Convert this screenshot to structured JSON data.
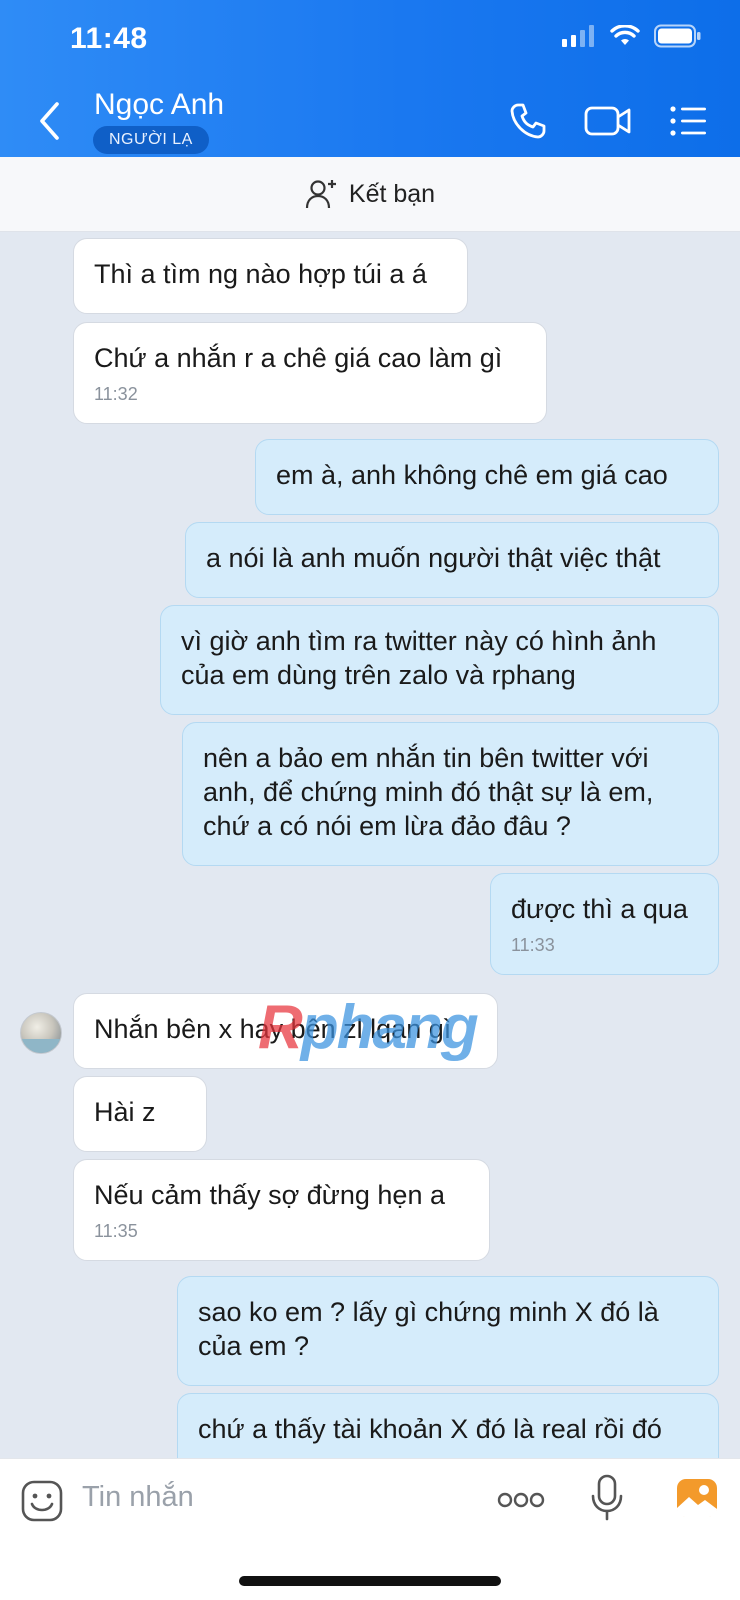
{
  "status_bar": {
    "time": "11:48"
  },
  "header": {
    "contact_name": "Ngọc Anh",
    "badge": "NGƯỜI LẠ"
  },
  "friend_bar": {
    "label": "Kết bạn"
  },
  "messages": [
    {
      "direction": "in",
      "text": "Thì a tìm ng nào hợp túi a á"
    },
    {
      "direction": "in",
      "text": "Chứ a nhắn r a chê giá cao làm gì",
      "time": "11:32"
    },
    {
      "direction": "out",
      "text": "em à, anh không chê em giá cao"
    },
    {
      "direction": "out",
      "text": "a nói là anh muốn người thật việc thật"
    },
    {
      "direction": "out",
      "text": "vì giờ anh tìm ra twitter này có hình ảnh của em dùng trên zalo và rphang"
    },
    {
      "direction": "out",
      "text": "nên a bảo em nhắn tin bên twitter với anh, để chứng minh đó thật sự là em, chứ a có nói em lừa đảo đâu ?"
    },
    {
      "direction": "out",
      "text": "được thì a qua",
      "time": "11:33"
    },
    {
      "direction": "in",
      "text": "Nhắn bên x hay bên zl lqan gì"
    },
    {
      "direction": "in",
      "text": "Hài z"
    },
    {
      "direction": "in",
      "text": "Nếu cảm thấy sợ đừng hẹn a",
      "time": "11:35"
    },
    {
      "direction": "out",
      "text": "sao ko em ? lấy gì chứng minh X đó là của em ?"
    },
    {
      "direction": "out",
      "text": "chứ a thấy tài khoản X đó là real rồi đó"
    }
  ],
  "watermark": {
    "r": "R",
    "rest": "phang"
  },
  "composer": {
    "placeholder": "Tin nhắn"
  },
  "icons": {
    "back": "chevron-left-icon",
    "call": "phone-icon",
    "video": "video-camera-icon",
    "menu": "list-icon",
    "add_friend": "person-add-icon",
    "sticker": "sticker-face-icon",
    "more": "more-dots-icon",
    "mic": "microphone-icon",
    "gallery": "image-icon"
  },
  "colors": {
    "header": "#1a78f0",
    "outgoing_bubble": "#d5ecfb",
    "incoming_bubble": "#ffffff",
    "chat_background": "#e2e8f1",
    "gallery_icon": "#f39a2b"
  }
}
